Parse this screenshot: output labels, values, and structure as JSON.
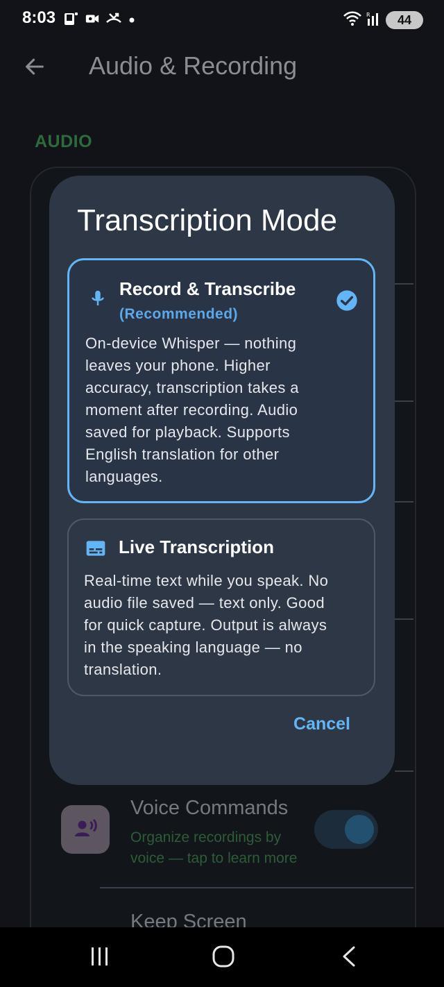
{
  "status_bar": {
    "time": "8:03",
    "battery": "44",
    "left_icons": [
      "phone-notification-icon",
      "video-call-icon",
      "missed-call-icon",
      "dot-icon"
    ],
    "right_icons": [
      "wifi-icon",
      "signal-icon",
      "battery-icon"
    ]
  },
  "app_bar": {
    "title": "Audio & Recording",
    "back_icon": "arrow-back-icon"
  },
  "section": {
    "label": "AUDIO"
  },
  "background_items": {
    "voice_commands": {
      "title": "Voice Commands",
      "subtitle": "Organize recordings by voice — tap to learn more",
      "toggle_on": true,
      "icon": "voice-command-icon"
    },
    "keep_screen": {
      "title": "Keep Screen"
    }
  },
  "dialog": {
    "title": "Transcription Mode",
    "options": [
      {
        "icon": "microphone-icon",
        "title": "Record & Transcribe",
        "tag": "(Recommended)",
        "selected": true,
        "description_lines": [
          "On-device Whisper — nothing",
          "leaves your phone. Higher",
          "accuracy, transcription takes a",
          "moment after recording. Audio",
          "saved for playback. Supports",
          "English translation for other",
          "languages."
        ]
      },
      {
        "icon": "subtitles-icon",
        "title": "Live Transcription",
        "selected": false,
        "description_lines": [
          "Real-time text while you speak. No",
          "audio file saved — text only. Good",
          "for quick capture. Output is always",
          "in the speaking language — no",
          "translation."
        ]
      }
    ],
    "cancel_label": "Cancel"
  },
  "colors": {
    "accent": "#64b5f6",
    "dialog_bg": "#2e3746",
    "section_green": "#2f6a3c"
  },
  "nav_bar": {
    "icons": [
      "recent-apps-icon",
      "home-icon",
      "back-icon"
    ]
  }
}
